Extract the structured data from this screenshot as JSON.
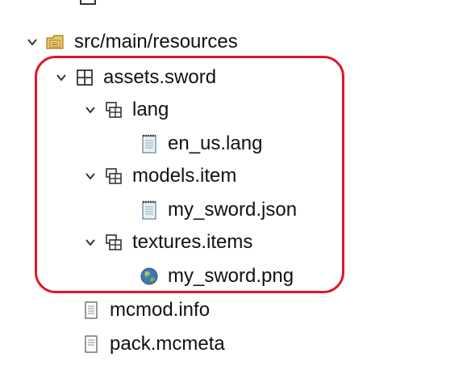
{
  "tree": {
    "items": [
      {
        "label": "src/main/resources",
        "icon": "source-folder-icon",
        "expanded": true
      },
      {
        "label": "assets.sword",
        "icon": "package-icon",
        "expanded": true
      },
      {
        "label": "lang",
        "icon": "package-icon",
        "expanded": true
      },
      {
        "label": "en_us.lang",
        "icon": "text-file-icon"
      },
      {
        "label": "models.item",
        "icon": "package-icon",
        "expanded": true
      },
      {
        "label": "my_sword.json",
        "icon": "text-file-icon"
      },
      {
        "label": "textures.items",
        "icon": "package-icon",
        "expanded": true
      },
      {
        "label": "my_sword.png",
        "icon": "image-file-icon"
      },
      {
        "label": "mcmod.info",
        "icon": "file-icon"
      },
      {
        "label": "pack.mcmeta",
        "icon": "file-icon"
      }
    ]
  },
  "highlight": {
    "color": "#e0162b"
  }
}
